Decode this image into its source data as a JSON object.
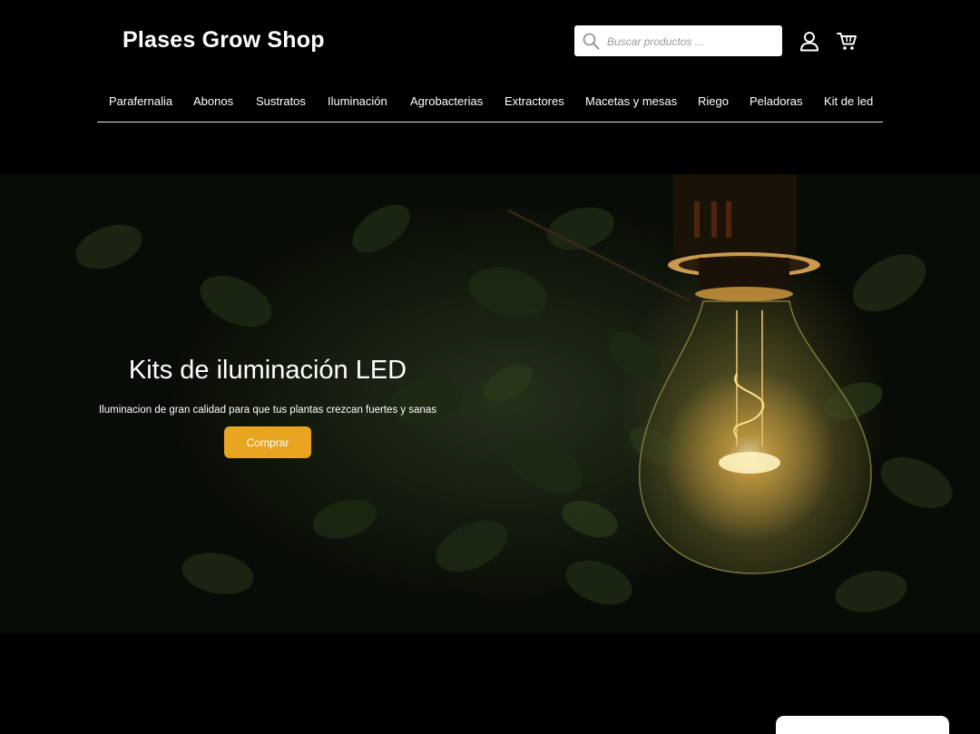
{
  "header": {
    "logo_text": "Plases Grow Shop",
    "search": {
      "placeholder": "Buscar productos ...",
      "value": ""
    },
    "icons": {
      "search": "search-icon",
      "account": "user-icon",
      "cart": "cart-icon"
    }
  },
  "nav": {
    "items": [
      {
        "label": "Parafernalia"
      },
      {
        "label": "Abonos"
      },
      {
        "label": "Sustratos"
      },
      {
        "label": "Iluminación"
      },
      {
        "label": "Agrobacterias"
      },
      {
        "label": "Extractores"
      },
      {
        "label": "Macetas y mesas"
      },
      {
        "label": "Riego"
      },
      {
        "label": "Peladoras"
      },
      {
        "label": "Kit de led"
      }
    ]
  },
  "hero": {
    "title": "Kits de iluminación LED",
    "subtitle": "Iluminacion de gran calidad para que tus plantas crezcan fuertes y sanas",
    "button_label": "Comprar"
  },
  "colors": {
    "background": "#000000",
    "accent": "#e8a51f",
    "text": "#ffffff"
  }
}
